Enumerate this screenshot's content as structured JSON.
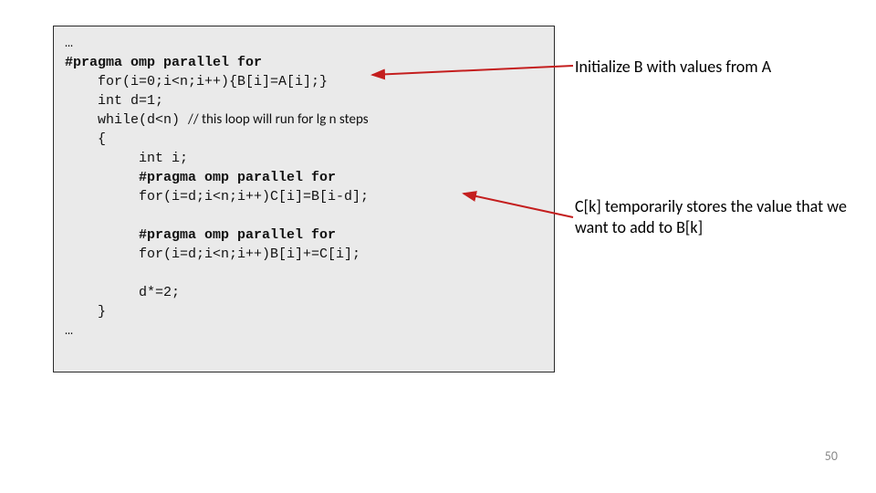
{
  "code": {
    "l1": "…",
    "l2": "#pragma omp parallel for",
    "l3_a": "    for(i=0;i<n;i++){B[i]=A[i];}",
    "l4": "    int d=1;",
    "l5_a": "    while(d<n) ",
    "l5_comment": "// this loop will run for lg n steps",
    "l6": "    {",
    "l7": "         int i;",
    "l8": "         #pragma omp parallel for",
    "l9": "         for(i=d;i<n;i++)C[i]=B[i-d];",
    "l10": "",
    "l11": "         #pragma omp parallel for",
    "l12": "         for(i=d;i<n;i++)B[i]+=C[i];",
    "l13": "",
    "l14": "         d*=2;",
    "l15": "    }",
    "l16": "…"
  },
  "annotations": {
    "a1": "Initialize B with values from A",
    "a2": "C[k] temporarily stores the value that we want to add to B[k]"
  },
  "page_number": "50"
}
